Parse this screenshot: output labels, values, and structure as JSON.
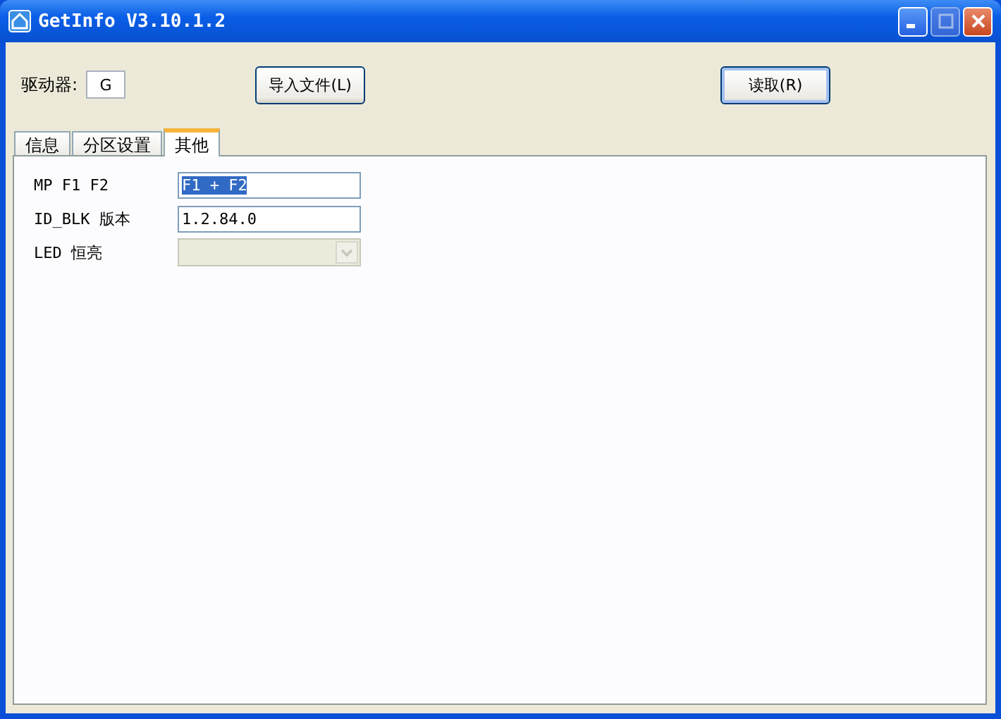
{
  "window": {
    "title": "GetInfo V3.10.1.2"
  },
  "drive": {
    "label": "驱动器:",
    "value": "G"
  },
  "buttons": [
    {
      "label": "导入文件(L)",
      "focused": false
    },
    {
      "label": "读取(R)",
      "focused": true
    }
  ],
  "tabs": [
    {
      "label": "信息",
      "selected": false
    },
    {
      "label": "分区设置",
      "selected": false
    },
    {
      "label": "其他",
      "selected": true
    }
  ],
  "fields": [
    {
      "kind": "text",
      "label": "MP F1 F2",
      "value": "F1 + F2",
      "highlighted": true,
      "disabled": false
    },
    {
      "kind": "text",
      "label": "ID_BLK 版本",
      "value": "1.2.84.0",
      "highlighted": false,
      "disabled": false
    },
    {
      "kind": "combo",
      "label": "LED 恒亮",
      "disabled": true
    }
  ]
}
